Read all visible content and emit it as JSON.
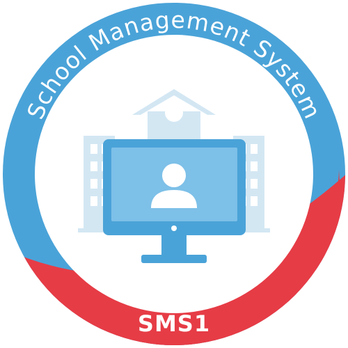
{
  "badge": {
    "title": "School Management System",
    "code": "SMS1"
  },
  "colors": {
    "ring_blue": "#4aa3d8",
    "ring_red": "#e63c46",
    "building": "#d3e7f3",
    "monitor": "#4aa3d8",
    "screen": "#7dc0e8",
    "user": "#ffffff"
  },
  "icons": {
    "building": "school-building-icon",
    "monitor": "computer-monitor-icon",
    "user": "user-avatar-icon"
  }
}
